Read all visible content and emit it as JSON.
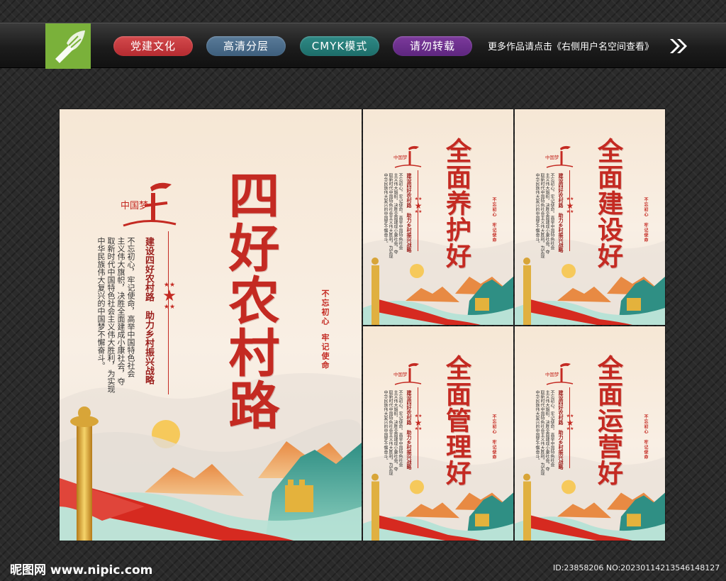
{
  "banner": {
    "tags": [
      "党建文化",
      "高清分层",
      "CMYK模式",
      "请勿转载"
    ],
    "more_text": "更多作品请点击《右侧用户名空间查看》",
    "logo_icon": "pen-nib-icon",
    "arrow_icon": "double-chevron-right-icon"
  },
  "main_poster": {
    "logo_text": "中国梦",
    "title": "四好农村路",
    "subtitle": "建设四好农村路　助力乡村振兴战略",
    "body_lines": [
      "不忘初心，牢记使命，高举中国特色社会",
      "主义伟大旗帜，决胜全面建成小康社会，夺",
      "取新时代中国特色社会主义伟大胜利，为实现",
      "中华民族伟大复兴的中国梦不懈奋斗。"
    ],
    "seal_lines": [
      "不忘初心",
      "牢记使命"
    ]
  },
  "small_posters": [
    {
      "title": "全面养护好",
      "subtitle": "建设四好农村路　助力乡村振兴战略",
      "seal_lines": [
        "不忘初心",
        "牢记使命"
      ]
    },
    {
      "title": "全面建设好",
      "subtitle": "建设四好农村路　助力乡村振兴战略",
      "seal_lines": [
        "不忘初心",
        "牢记使命"
      ]
    },
    {
      "title": "全面管理好",
      "subtitle": "建设四好农村路　助力乡村振兴战略",
      "seal_lines": [
        "不忘初心",
        "牢记使命"
      ]
    },
    {
      "title": "全面运营好",
      "subtitle": "建设四好农村路　助力乡村振兴战略",
      "seal_lines": [
        "不忘初心",
        "牢记使命"
      ]
    }
  ],
  "small_body_lines": [
    "不忘初心，牢记使命，高举中国特色社会",
    "主义伟大旗帜，决胜全面建成小康社会，夺",
    "取新时代中国特色社会主义伟大胜利，为实现",
    "中华民族伟大复兴的中国梦不懈奋斗。"
  ],
  "small_logo_text": "中国梦",
  "watermark": {
    "site": "昵图网 www.nipic.com",
    "id_text": "ID:23858206 NO:20230114213546148127"
  },
  "colors": {
    "accent_red": "#c42a22",
    "paper": "#f6e7d5",
    "mountain_teal": "#3f9b8f",
    "mountain_orange": "#e07a3a"
  }
}
